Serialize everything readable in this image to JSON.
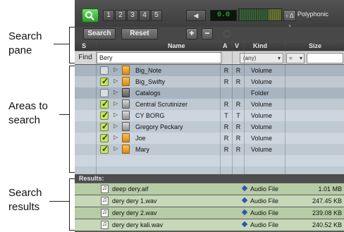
{
  "annotations": {
    "search_pane": [
      "Search",
      "pane"
    ],
    "areas_to_search": [
      "Areas to",
      "search"
    ],
    "search_results": [
      "Search",
      "results"
    ]
  },
  "toolbar": {
    "search_icon": "magnifier-icon",
    "preset_buttons": [
      "1",
      "2",
      "3",
      "4",
      "5"
    ],
    "volume_icon": "speaker-icon",
    "level_readout": "0.0",
    "voice_mode": "Polyphonic",
    "voice_arrow": "‹ ∆ ›"
  },
  "search_bar": {
    "search_label": "Search",
    "reset_label": "Reset",
    "add_label": "+",
    "remove_label": "−"
  },
  "columns": {
    "s": "S",
    "name": "Name",
    "a": "A",
    "v": "V",
    "kind": "Kind",
    "size": "Size"
  },
  "find": {
    "label": "Find",
    "value": "Bery",
    "kind_value": "(any)",
    "op_value": "="
  },
  "locations": [
    {
      "checked": false,
      "name": "Big_Note",
      "a": "R",
      "v": "R",
      "kind": "Volume",
      "icon": "orange-volume-icon"
    },
    {
      "checked": true,
      "name": "Big_Swifty",
      "a": "R",
      "v": "R",
      "kind": "Volume",
      "icon": "orange-volume-icon"
    },
    {
      "checked": false,
      "name": "Catalogs",
      "a": "",
      "v": "",
      "kind": "Folder",
      "icon": "catalog-folder-icon"
    },
    {
      "checked": true,
      "name": "Central Scrutinizer",
      "a": "R",
      "v": "R",
      "kind": "Volume",
      "icon": "grey-volume-icon"
    },
    {
      "checked": true,
      "name": "CY BORG",
      "a": "T",
      "v": "T",
      "kind": "Volume",
      "icon": "grey-volume-icon"
    },
    {
      "checked": true,
      "name": "Gregory Peckary",
      "a": "R",
      "v": "R",
      "kind": "Volume",
      "icon": "grey-volume-icon"
    },
    {
      "checked": true,
      "name": "Joe",
      "a": "R",
      "v": "R",
      "kind": "Volume",
      "icon": "orange-volume-icon"
    },
    {
      "checked": true,
      "name": "Mary",
      "a": "R",
      "v": "R",
      "kind": "Volume",
      "icon": "orange-volume-icon"
    }
  ],
  "results_header": "Results:",
  "results": [
    {
      "name": "deep dery.aif",
      "kind": "Audio File",
      "size": "1.01 MB"
    },
    {
      "name": "dery dery 1.wav",
      "kind": "Audio File",
      "size": "247.45 KB"
    },
    {
      "name": "dery dery 2.wav",
      "kind": "Audio File",
      "size": "239.08 KB"
    },
    {
      "name": "dery dery kali.wav",
      "kind": "Audio File",
      "size": "240.52 KB"
    }
  ],
  "colors": {
    "search_button": "#3fbf3f",
    "location_row": "#bfc9d2",
    "result_row": "#b6cca6",
    "lcd_text": "#3fd13f"
  }
}
